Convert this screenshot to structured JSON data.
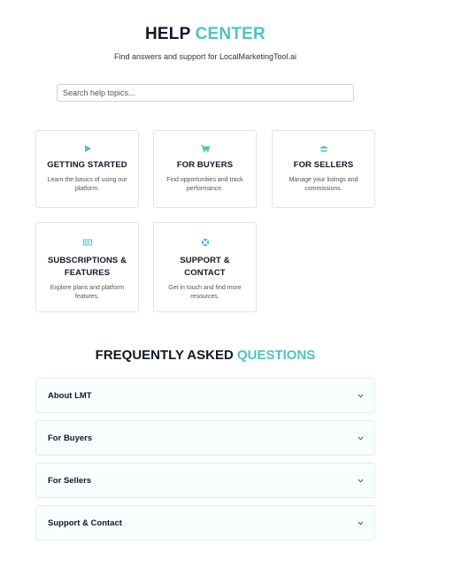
{
  "header": {
    "title_dark": "HELP",
    "title_accent": "CENTER",
    "subtitle": "Find answers and support for LocalMarketingTool.ai"
  },
  "search": {
    "placeholder": "Search help topics..."
  },
  "cards": [
    {
      "icon": "play-icon",
      "title": "GETTING STARTED",
      "description": "Learn the basics of using our platform."
    },
    {
      "icon": "cart-icon",
      "title": "FOR BUYERS",
      "description": "Find opportunities and track performance."
    },
    {
      "icon": "users-icon",
      "title": "FOR SELLERS",
      "description": "Manage your listings and commissions."
    },
    {
      "icon": "barcode-icon",
      "title": "SUBSCRIPTIONS & FEATURES",
      "description": "Explore plans and platform features."
    },
    {
      "icon": "lifebuoy-icon",
      "title": "SUPPORT & CONTACT",
      "description": "Get in touch and find more resources."
    }
  ],
  "faq": {
    "title_dark": "FREQUENTLY ASKED",
    "title_accent": "QUESTIONS",
    "items": [
      {
        "label": "About LMT"
      },
      {
        "label": "For Buyers"
      },
      {
        "label": "For Sellers"
      },
      {
        "label": "Support & Contact"
      }
    ]
  },
  "colors": {
    "accent": "#4ec3c1",
    "heading": "#111827",
    "faq_background": "#f8fdfd"
  }
}
